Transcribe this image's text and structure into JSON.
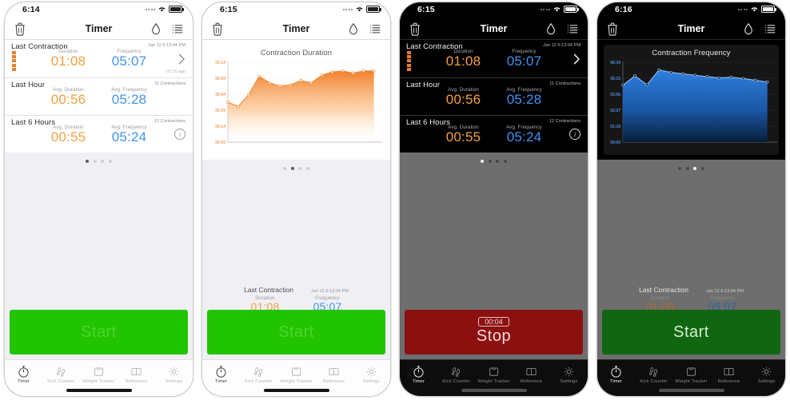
{
  "app": {
    "title": "Timer"
  },
  "panels": [
    {
      "id": "panel-summary-light",
      "theme": "light",
      "time": "6:14",
      "nav_title": "Timer",
      "view": "summary",
      "cells": [
        {
          "title": "Last Contraction",
          "meta": "Jan 12 6:13:04 PM",
          "sub": "01:25 ago",
          "metrics": [
            {
              "label": "Duration",
              "value": "01:08",
              "color": "orange"
            },
            {
              "label": "Frequency",
              "value": "05:07",
              "color": "blue"
            }
          ],
          "accessory": "chevron",
          "intensity_blocks": 5
        },
        {
          "title": "Last Hour",
          "meta": "11 Contractions",
          "sub": "",
          "metrics": [
            {
              "label": "Avg. Duration",
              "value": "00:56",
              "color": "orange"
            },
            {
              "label": "Avg. Frequency",
              "value": "05:28",
              "color": "blue"
            }
          ],
          "accessory": "none",
          "intensity_blocks": 0
        },
        {
          "title": "Last 6 Hours",
          "meta": "12 Contractions",
          "sub": "",
          "metrics": [
            {
              "label": "Avg. Duration",
              "value": "00:55",
              "color": "orange"
            },
            {
              "label": "Avg. Frequency",
              "value": "05:24",
              "color": "blue"
            }
          ],
          "accessory": "info",
          "intensity_blocks": 0
        }
      ],
      "page_dots": {
        "count": 4,
        "active": 0
      },
      "action": {
        "type": "start",
        "label": "Start",
        "badge": ""
      }
    },
    {
      "id": "panel-duration-chart-light",
      "theme": "light",
      "time": "6:15",
      "nav_title": "Timer",
      "view": "chart",
      "page_dots": {
        "count": 4,
        "active": 1
      },
      "last_bar": {
        "title": "Last Contraction",
        "date": "Jan 12 6:13:04 PM",
        "metrics": [
          {
            "label": "Duration",
            "value": "01:08",
            "color": "orange"
          },
          {
            "label": "Frequency",
            "value": "05:07",
            "color": "blue"
          }
        ]
      },
      "action": {
        "type": "start",
        "label": "Start",
        "badge": ""
      }
    },
    {
      "id": "panel-summary-dark-running",
      "theme": "dark",
      "time": "6:15",
      "nav_title": "Timer",
      "view": "summary",
      "cells": [
        {
          "title": "Last Contraction",
          "meta": "Jan 12 6:13:04 PM",
          "sub": "",
          "metrics": [
            {
              "label": "Duration",
              "value": "01:08",
              "color": "orange"
            },
            {
              "label": "Frequency",
              "value": "05:07",
              "color": "blue"
            }
          ],
          "accessory": "chevron",
          "intensity_blocks": 5
        },
        {
          "title": "Last Hour",
          "meta": "11 Contractions",
          "sub": "",
          "metrics": [
            {
              "label": "Avg. Duration",
              "value": "00:56",
              "color": "orange"
            },
            {
              "label": "Avg. Frequency",
              "value": "05:28",
              "color": "blue"
            }
          ],
          "accessory": "none",
          "intensity_blocks": 0
        },
        {
          "title": "Last 6 Hours",
          "meta": "12 Contractions",
          "sub": "",
          "metrics": [
            {
              "label": "Avg. Duration",
              "value": "00:55",
              "color": "orange"
            },
            {
              "label": "Avg. Frequency",
              "value": "05:24",
              "color": "blue"
            }
          ],
          "accessory": "info",
          "intensity_blocks": 0
        }
      ],
      "page_dots": {
        "count": 4,
        "active": 0
      },
      "action": {
        "type": "stop",
        "label": "Stop",
        "badge": "00:04"
      }
    },
    {
      "id": "panel-frequency-chart-dark",
      "theme": "dark2",
      "time": "6:16",
      "nav_title": "Timer",
      "view": "chart",
      "page_dots": {
        "count": 4,
        "active": 2
      },
      "last_bar": {
        "title": "Last Contraction",
        "date": "Jan 12 6:13:04 PM",
        "metrics": [
          {
            "label": "Duration",
            "value": "01:08",
            "color": "orange"
          },
          {
            "label": "Frequency",
            "value": "05:07",
            "color": "blue"
          }
        ]
      },
      "action": {
        "type": "start",
        "label": "Start",
        "badge": ""
      }
    }
  ],
  "tabs": [
    {
      "label": "Timer",
      "icon": "stopwatch-icon",
      "active": true
    },
    {
      "label": "Kick Counter",
      "icon": "footprints-icon",
      "active": false
    },
    {
      "label": "Weight Tracker",
      "icon": "scale-icon",
      "active": false
    },
    {
      "label": "Reference",
      "icon": "book-icon",
      "active": false
    },
    {
      "label": "Settings",
      "icon": "gear-icon",
      "active": false
    }
  ],
  "colors": {
    "orange": "#f5a040",
    "blue": "#3f94f2",
    "start_green": "#22c400",
    "start_green_dim": "#116611",
    "stop_red": "#8b1111",
    "light_bg": "#efeff4",
    "dark_bg": "#6e6e6e"
  },
  "chart_data": [
    {
      "type": "area",
      "id": "contraction-duration",
      "title": "Contraction Duration",
      "xlabel": "",
      "ylabel": "",
      "yticks": [
        "00:00",
        "00:14",
        "00:29",
        "00:44",
        "00:59",
        "01:14"
      ],
      "ylim": [
        0,
        74
      ],
      "grid": true,
      "legend": "none",
      "line_color": "#f08a33",
      "fill_color": "#f79a45",
      "x": [
        1,
        2,
        3,
        4,
        5,
        6,
        7,
        8,
        9,
        10,
        11,
        12,
        13,
        14,
        15
      ],
      "values": [
        37,
        33,
        44,
        61,
        55,
        52,
        53,
        57,
        55,
        62,
        65,
        66,
        64,
        66,
        66
      ],
      "value_labels": [
        "00:37",
        "00:33",
        "00:44",
        "01:01",
        "00:55",
        "00:52",
        "00:53",
        "00:57",
        "00:55",
        "01:02",
        "01:05",
        "01:06",
        "01:04",
        "01:06",
        "01:06"
      ]
    },
    {
      "type": "area",
      "id": "contraction-frequency",
      "title": "Contraction Frequency",
      "xlabel": "",
      "ylabel": "",
      "yticks": [
        "00:00",
        "01:18",
        "02:37",
        "03:56",
        "05:15",
        "06:34"
      ],
      "ylim": [
        0,
        394
      ],
      "grid": true,
      "legend": "none",
      "line_color": "#8fbff0",
      "fill_color": "#1a62c8",
      "x": [
        1,
        2,
        3,
        4,
        5,
        6,
        7,
        8,
        9,
        10,
        11,
        12,
        13
      ],
      "values": [
        281,
        327,
        283,
        356,
        344,
        337,
        330,
        323,
        317,
        320,
        314,
        305,
        297
      ],
      "value_labels": [
        "04:41",
        "05:27",
        "04:43",
        "05:56",
        "05:44",
        "05:37",
        "05:30",
        "05:23",
        "05:17",
        "05:20",
        "05:14",
        "05:05",
        "04:57"
      ]
    }
  ]
}
